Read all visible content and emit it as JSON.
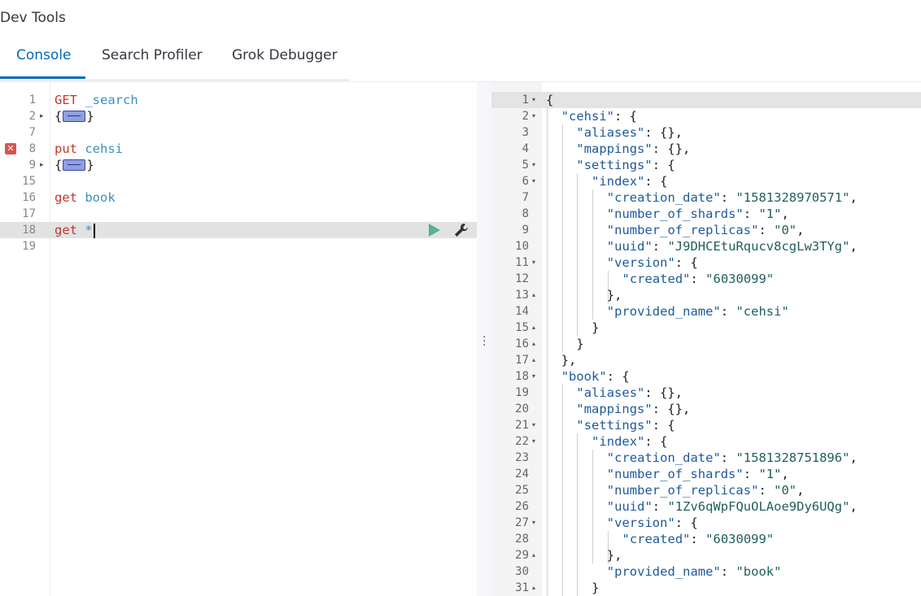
{
  "app": {
    "title": "Dev Tools"
  },
  "tabs": [
    {
      "label": "Console",
      "active": true
    },
    {
      "label": "Search Profiler",
      "active": false
    },
    {
      "label": "Grok Debugger",
      "active": false
    }
  ],
  "editor": {
    "lines": [
      {
        "num": "1",
        "fold": "",
        "method": "GET",
        "path": "_search",
        "collapsed": false
      },
      {
        "num": "2",
        "fold": "▸",
        "method": "",
        "path": "",
        "collapsed": true
      },
      {
        "num": "7",
        "fold": "",
        "method": "",
        "path": "",
        "collapsed": false
      },
      {
        "num": "8",
        "fold": "",
        "method": "put",
        "path": "cehsi",
        "collapsed": false,
        "error": true
      },
      {
        "num": "9",
        "fold": "▸",
        "method": "",
        "path": "",
        "collapsed": true
      },
      {
        "num": "15",
        "fold": "",
        "method": "",
        "path": "",
        "collapsed": false
      },
      {
        "num": "16",
        "fold": "",
        "method": "get",
        "path": "book",
        "collapsed": false
      },
      {
        "num": "17",
        "fold": "",
        "method": "",
        "path": "",
        "collapsed": false
      },
      {
        "num": "18",
        "fold": "",
        "method": "get",
        "path": "*",
        "collapsed": false,
        "active": true
      },
      {
        "num": "19",
        "fold": "",
        "method": "",
        "path": "",
        "collapsed": false
      }
    ],
    "error_icon": "x-icon",
    "run_icon": "play-icon",
    "settings_icon": "wrench-icon",
    "colors": {
      "method": "#c0392b",
      "path": "#3a8fc4",
      "run": "#54b399"
    }
  },
  "output": {
    "lines": [
      {
        "num": "1",
        "fold": "▾",
        "indent": 0,
        "text": "{"
      },
      {
        "num": "2",
        "fold": "▾",
        "indent": 1,
        "key": "\"cehsi\"",
        "rest": ": {"
      },
      {
        "num": "3",
        "fold": "",
        "indent": 2,
        "key": "\"aliases\"",
        "rest": ": {},"
      },
      {
        "num": "4",
        "fold": "",
        "indent": 2,
        "key": "\"mappings\"",
        "rest": ": {},"
      },
      {
        "num": "5",
        "fold": "▾",
        "indent": 2,
        "key": "\"settings\"",
        "rest": ": {"
      },
      {
        "num": "6",
        "fold": "▾",
        "indent": 3,
        "key": "\"index\"",
        "rest": ": {"
      },
      {
        "num": "7",
        "fold": "",
        "indent": 4,
        "key": "\"creation_date\"",
        "rest": ": ",
        "val": "\"1581328970571\"",
        "tail": ","
      },
      {
        "num": "8",
        "fold": "",
        "indent": 4,
        "key": "\"number_of_shards\"",
        "rest": ": ",
        "val": "\"1\"",
        "tail": ","
      },
      {
        "num": "9",
        "fold": "",
        "indent": 4,
        "key": "\"number_of_replicas\"",
        "rest": ": ",
        "val": "\"0\"",
        "tail": ","
      },
      {
        "num": "10",
        "fold": "",
        "indent": 4,
        "key": "\"uuid\"",
        "rest": ": ",
        "val": "\"J9DHCEtuRqucv8cgLw3TYg\"",
        "tail": ","
      },
      {
        "num": "11",
        "fold": "▾",
        "indent": 4,
        "key": "\"version\"",
        "rest": ": {"
      },
      {
        "num": "12",
        "fold": "",
        "indent": 5,
        "key": "\"created\"",
        "rest": ": ",
        "val": "\"6030099\"",
        "tail": ""
      },
      {
        "num": "13",
        "fold": "▴",
        "indent": 4,
        "text": "},"
      },
      {
        "num": "14",
        "fold": "",
        "indent": 4,
        "key": "\"provided_name\"",
        "rest": ": ",
        "val": "\"cehsi\"",
        "tail": ""
      },
      {
        "num": "15",
        "fold": "▴",
        "indent": 3,
        "text": "}"
      },
      {
        "num": "16",
        "fold": "▴",
        "indent": 2,
        "text": "}"
      },
      {
        "num": "17",
        "fold": "▴",
        "indent": 1,
        "text": "},"
      },
      {
        "num": "18",
        "fold": "▾",
        "indent": 1,
        "key": "\"book\"",
        "rest": ": {"
      },
      {
        "num": "19",
        "fold": "",
        "indent": 2,
        "key": "\"aliases\"",
        "rest": ": {},"
      },
      {
        "num": "20",
        "fold": "",
        "indent": 2,
        "key": "\"mappings\"",
        "rest": ": {},"
      },
      {
        "num": "21",
        "fold": "▾",
        "indent": 2,
        "key": "\"settings\"",
        "rest": ": {"
      },
      {
        "num": "22",
        "fold": "▾",
        "indent": 3,
        "key": "\"index\"",
        "rest": ": {"
      },
      {
        "num": "23",
        "fold": "",
        "indent": 4,
        "key": "\"creation_date\"",
        "rest": ": ",
        "val": "\"1581328751896\"",
        "tail": ","
      },
      {
        "num": "24",
        "fold": "",
        "indent": 4,
        "key": "\"number_of_shards\"",
        "rest": ": ",
        "val": "\"1\"",
        "tail": ","
      },
      {
        "num": "25",
        "fold": "",
        "indent": 4,
        "key": "\"number_of_replicas\"",
        "rest": ": ",
        "val": "\"0\"",
        "tail": ","
      },
      {
        "num": "26",
        "fold": "",
        "indent": 4,
        "key": "\"uuid\"",
        "rest": ": ",
        "val": "\"1Zv6qWpFQuOLAoe9Dy6UQg\"",
        "tail": ","
      },
      {
        "num": "27",
        "fold": "▾",
        "indent": 4,
        "key": "\"version\"",
        "rest": ": {"
      },
      {
        "num": "28",
        "fold": "",
        "indent": 5,
        "key": "\"created\"",
        "rest": ": ",
        "val": "\"6030099\"",
        "tail": ""
      },
      {
        "num": "29",
        "fold": "▴",
        "indent": 4,
        "text": "},"
      },
      {
        "num": "30",
        "fold": "",
        "indent": 4,
        "key": "\"provided_name\"",
        "rest": ": ",
        "val": "\"book\"",
        "tail": ""
      },
      {
        "num": "31",
        "fold": "▴",
        "indent": 3,
        "text": "}"
      }
    ]
  }
}
